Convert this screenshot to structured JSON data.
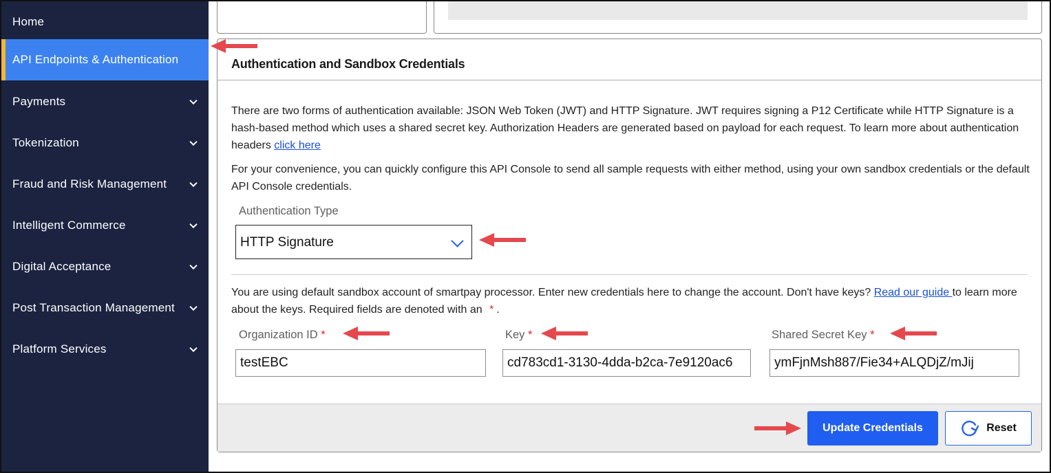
{
  "sidebar": {
    "items": [
      {
        "label": "Home",
        "expandable": false,
        "active": false
      },
      {
        "label": "API Endpoints & Authentication",
        "expandable": false,
        "active": true
      },
      {
        "label": "Payments",
        "expandable": true,
        "active": false
      },
      {
        "label": "Tokenization",
        "expandable": true,
        "active": false
      },
      {
        "label": "Fraud and Risk Management",
        "expandable": true,
        "active": false
      },
      {
        "label": "Intelligent Commerce",
        "expandable": true,
        "active": false
      },
      {
        "label": "Digital Acceptance",
        "expandable": true,
        "active": false
      },
      {
        "label": "Post Transaction Management",
        "expandable": true,
        "active": false
      },
      {
        "label": "Platform Services",
        "expandable": true,
        "active": false
      }
    ]
  },
  "panel": {
    "title": "Authentication and Sandbox Credentials",
    "intro_text": "There are two forms of authentication available: JSON Web Token (JWT) and HTTP Signature. JWT requires signing a P12 Certificate while HTTP Signature is a hash-based method which uses a shared secret key. Authorization Headers are generated based on payload for each request. To learn more about authentication headers ",
    "intro_link": "click here",
    "convenience_text": "For your convenience, you can quickly configure this API Console to send all sample requests with either method, using your own sandbox credentials or the default API Console credentials.",
    "auth_type_label": "Authentication Type",
    "auth_type_value": "HTTP Signature",
    "sandbox_text_1": "You are using default sandbox account of smartpay processor. Enter new credentials here to change the account. Don't have keys? ",
    "sandbox_link": "Read our guide ",
    "sandbox_text_2": "to learn more about the keys. Required fields are denoted with an ",
    "required_marker": "*",
    "sandbox_text_3": ".",
    "fields": {
      "org_id": {
        "label": "Organization ID",
        "value": "testEBC"
      },
      "key": {
        "label": "Key",
        "value": "cd783cd1-3130-4dda-b2ca-7e9120ac6"
      },
      "shared_secret": {
        "label": "Shared Secret Key",
        "value": "ymFjnMsh887/Fie34+ALQDjZ/mJij"
      }
    }
  },
  "footer": {
    "update_label": "Update Credentials",
    "reset_label": "Reset"
  },
  "colors": {
    "sidebar_bg": "#1b2340",
    "active_bg": "#3b82f0",
    "active_accent": "#f5b82e",
    "primary_button": "#1f5ef0",
    "annotation_arrow": "#e5484d"
  }
}
